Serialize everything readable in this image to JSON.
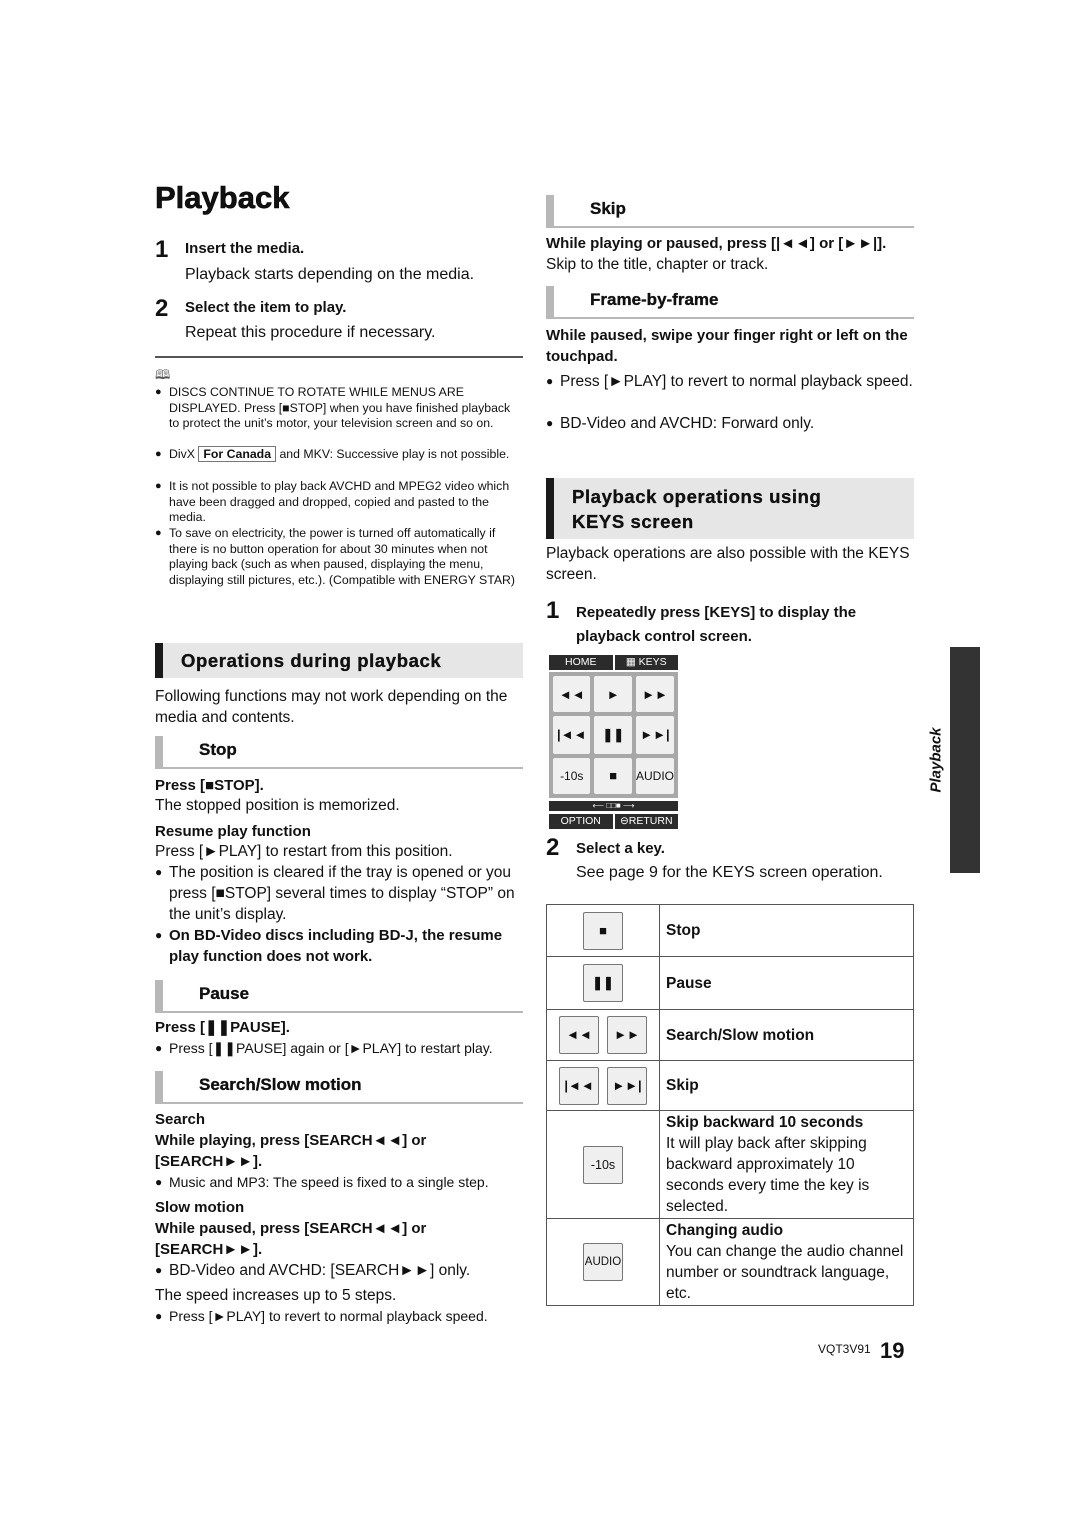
{
  "page": {
    "title": "Playback",
    "side_tab": "Playback",
    "footer_code": "VQT3V91",
    "page_number": "19"
  },
  "left": {
    "steps": [
      {
        "num": "1",
        "title": "Insert the media.",
        "desc": "Playback starts depending on the media."
      },
      {
        "num": "2",
        "title": "Select the item to play.",
        "desc": "Repeat this procedure if necessary."
      }
    ],
    "notes_icon": "book-icon",
    "notes": [
      {
        "pre": "DISCS CONTINUE TO ROTATE WHILE MENUS ARE DISPLAYED. Press [■STOP] when you have finished playback to protect the unit’s motor, your television screen and so on."
      },
      {
        "pre": "DivX ",
        "boxed": "For Canada",
        "post": " and MKV: Successive play is not possible."
      },
      {
        "pre": "It is not possible to play back AVCHD and MPEG2 video which have been dragged and dropped, copied and pasted to the media."
      },
      {
        "pre": "To save on electricity, the power is turned off automatically if there is no button operation for about 30 minutes when not playing back (such as when paused, displaying the menu, displaying still pictures, etc.). (Compatible with ENERGY STAR)"
      }
    ],
    "operations": {
      "heading": "Operations during playback",
      "intro": "Following functions may not work depending on the media and contents."
    },
    "stop": {
      "heading": "Stop",
      "press": "Press [■STOP].",
      "desc": "The stopped position is memorized.",
      "resume_title": "Resume play function",
      "resume_desc": "Press [►PLAY] to restart from this position.",
      "bullet1": "The position is cleared if the tray is opened or you press [■STOP] several times to display “STOP” on the unit’s display.",
      "bullet2": "On BD-Video discs including BD-J, the resume play function does not work."
    },
    "pause": {
      "heading": "Pause",
      "press": "Press [❚❚PAUSE].",
      "bullet": "Press [❚❚PAUSE] again or [►PLAY] to restart play."
    },
    "search": {
      "heading": "Search/Slow motion",
      "search_title": "Search",
      "search_instr": "While playing, press [SEARCH◄◄] or [SEARCH►►].",
      "search_bullet": "Music and MP3: The speed is fixed to a single step.",
      "slow_title": "Slow motion",
      "slow_instr": "While paused, press [SEARCH◄◄] or [SEARCH►►].",
      "slow_bullet": "BD-Video and AVCHD: [SEARCH►►] only.",
      "speed_text": "The speed increases up to 5 steps.",
      "speed_bullet": "Press [►PLAY] to revert to normal playback speed."
    }
  },
  "right": {
    "skip": {
      "heading": "Skip",
      "instr": "While playing or paused, press [|◄◄] or [►►|].",
      "desc": "Skip to the title, chapter or track."
    },
    "frame": {
      "heading": "Frame-by-frame",
      "instr": "While paused, swipe your finger right or left on the touchpad.",
      "bullet1": "Press [►PLAY] to revert to normal playback speed.",
      "bullet2": "BD-Video and AVCHD: Forward only."
    },
    "keys": {
      "heading_line1": "Playback operations using",
      "heading_line2": "KEYS screen",
      "intro": "Playback operations are also possible with the KEYS screen.",
      "step1_num": "1",
      "step1": "Repeatedly press [KEYS] to display the playback control screen.",
      "step2_num": "2",
      "step2_title": "Select a key.",
      "step2_desc": "See page 9 for the KEYS screen operation."
    },
    "keys_screen": {
      "home": "HOME",
      "keys": "KEYS",
      "buttons": [
        "◄◄",
        "►",
        "►►",
        "|◄◄",
        "❚❚",
        "►►|",
        "-10s",
        "■",
        "AUDIO"
      ],
      "nav": "⟵ □□■ ⟶",
      "option": "OPTION",
      "return": "RETURN"
    },
    "key_table": [
      {
        "icons": [
          "■"
        ],
        "title": "Stop",
        "desc": ""
      },
      {
        "icons": [
          "❚❚"
        ],
        "title": "Pause",
        "desc": ""
      },
      {
        "icons": [
          "◄◄",
          "►►"
        ],
        "title": "Search/Slow motion",
        "desc": ""
      },
      {
        "icons": [
          "|◄◄",
          "►►|"
        ],
        "title": "Skip",
        "desc": ""
      },
      {
        "icons": [
          "-10s"
        ],
        "title": "Skip backward 10 seconds",
        "desc": "It will play back after skipping backward approximately 10 seconds every time the key is selected."
      },
      {
        "icons": [
          "AUDIO"
        ],
        "title": "Changing audio",
        "desc": "You can change the audio channel number or soundtrack language, etc."
      }
    ]
  }
}
